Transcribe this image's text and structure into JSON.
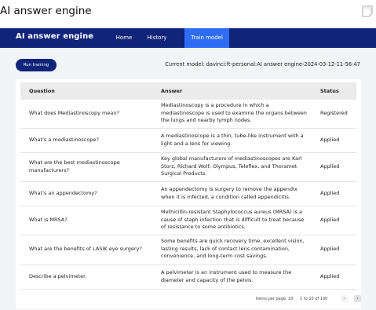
{
  "page": {
    "title": "AI answer engine"
  },
  "nav": {
    "brand": "AI answer engine",
    "tabs": [
      {
        "label": "Home"
      },
      {
        "label": "History"
      },
      {
        "label": "Train model",
        "active": true
      }
    ]
  },
  "toolbar": {
    "run_training_label": "Run training",
    "current_model": "Current model: davinci:ft-personal:AI answer engine-2024-03-12-11-56-47"
  },
  "table": {
    "columns": [
      "Question",
      "Answer",
      "Status"
    ],
    "rows": [
      {
        "question": "What does Mediastinoscopy mean?",
        "answer": "Mediastinoscopy is a procedure in which a mediastinoscope is used to examine the organs between the lungs and nearby lymph nodes.",
        "status": "Registered"
      },
      {
        "question": "What's a mediastinoscope?",
        "answer": "A mediastinoscope is a thin, tube-like instrument with a light and a lens for viewing.",
        "status": "Applied"
      },
      {
        "question": "What are the best mediastinoscope manufacturers?",
        "answer": "Key global manufacturers of mediastinoscopes are Karl Storz, Richard Wolf, Olympus, Teleflex, and Thoramet Surgical Products.",
        "status": "Applied"
      },
      {
        "question": "What's an appendectomy?",
        "answer": "An appendectomy is surgery to remove the appendix when it is infected, a condition called appendicitis.",
        "status": "Applied"
      },
      {
        "question": "What is MRSA?",
        "answer": "Methicillin-resistant Staphylococcus aureus (MRSA) is a cause of staph infection that is difficult to treat because of resistance to some antibiotics.",
        "status": "Applied"
      },
      {
        "question": "What are the benefits of LASIK eye surgery?",
        "answer": "Some benefits are quick recovery time, excellent vision, lasting results, lack of contact lens contamination, convenience, and long-term cost savings.",
        "status": "Applied"
      },
      {
        "question": "Describe a pelvimeter.",
        "answer": " A pelvimeter is an instrument used to measure the diameter and capacity of the pelvis.",
        "status": "Applied"
      }
    ]
  },
  "pagination": {
    "items_per_page": "Items per page: 10",
    "range": "1 to 10 of 100",
    "prev_icon": "chevron-left-icon",
    "next_icon": "chevron-right-icon"
  },
  "colors": {
    "nav_bg": "#10247a",
    "active_tab": "#2f6cf6",
    "content_bg": "#f3f4f6",
    "header_row": "#ebebeb"
  }
}
